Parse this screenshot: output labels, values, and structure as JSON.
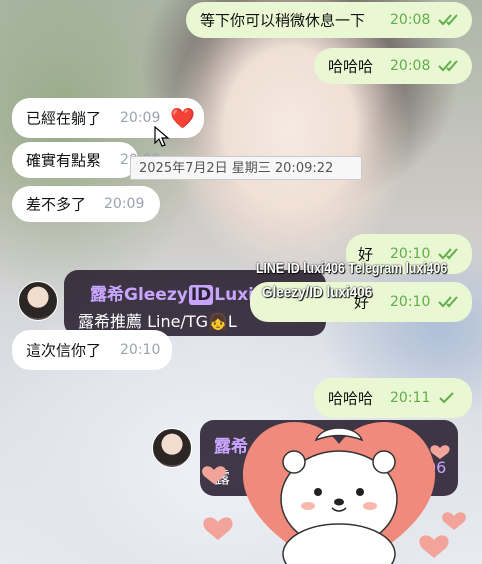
{
  "messages": [
    {
      "text": "等下你可以稍微休息一下",
      "time": "20:08",
      "read": true
    },
    {
      "text": "哈哈哈",
      "time": "20:08",
      "read": true
    },
    {
      "text": "已經在躺了",
      "time": "20:09",
      "reaction": "❤️"
    },
    {
      "text": "確實有點累",
      "time": "20:09"
    },
    {
      "text": "差不多了",
      "time": "20:09"
    },
    {
      "text": "好",
      "time": "20:10",
      "read": true
    },
    {
      "text": "好",
      "time": "20:10",
      "read": true
    },
    {
      "text": "這次信你了",
      "time": "20:10"
    },
    {
      "text": "哈哈哈",
      "time": "20:11",
      "read": false
    }
  ],
  "tooltip": {
    "text": "2025年7月2日 星期三 20:09:22"
  },
  "promo": {
    "line1_prefix": "露希Gleezy",
    "badge": "ID",
    "line1_suffix": "Luxi406",
    "line2": "露希推薦 Line/TG",
    "line2_emoji": "👧",
    "line2_tail": "L",
    "line1_prefix_partial": "露希",
    "line2_partial": "露",
    "line1_suffix_partial": "06"
  },
  "watermark": {
    "line1": "LINE ID luxi406 Telegram luxi406",
    "line2": "Gleezy/ID luxi406"
  },
  "colors": {
    "outgoing": "#e9f8d3",
    "incoming": "#ffffff",
    "time_out": "#5fae4a",
    "accent_purple": "#c7a5ff",
    "sticker_heart": "#f08a7c"
  }
}
